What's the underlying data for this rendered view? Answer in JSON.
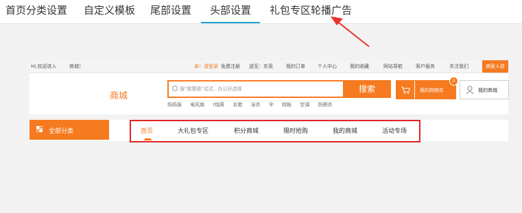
{
  "tabs": [
    "首页分类设置",
    "自定义模板",
    "尾部设置",
    "头部设置",
    "礼包专区轮播广告"
  ],
  "active_tab": "头部设置",
  "preview": {
    "topbar": {
      "welcome": "Hi,欢迎进入",
      "mall": "商城！",
      "login": "亲！请登录",
      "register": "免费注册",
      "deliver": "送至：东莞",
      "orders": "我的订单",
      "user_center": "个人中心",
      "favorites": "我的收藏",
      "site_nav": "网站导航",
      "service": "客户服务",
      "follow": "关注我们",
      "merchant": "商家入驻"
    },
    "logo": "商城",
    "search": {
      "placeholder": "搜\"健康禧\"试试，办公好选择",
      "button": "搜索"
    },
    "hotwords": [
      "妈妈装",
      "电风扇",
      "t恤男",
      "女鞋",
      "泳衣",
      "伞",
      "蚊帐",
      "空调",
      "防晒衣"
    ],
    "cart": {
      "label": "我的购物车",
      "count": "0"
    },
    "mystore": "我的商城",
    "allcat": "全部分类",
    "nav": [
      "首页",
      "大礼包专区",
      "积分商城",
      "限时抢购",
      "我的商城",
      "活动专场"
    ]
  },
  "colors": {
    "accent": "#f57a20",
    "tab_underline": "#1aa0c8",
    "highlight_box": "#e32222",
    "arrow": "#e8322e"
  }
}
